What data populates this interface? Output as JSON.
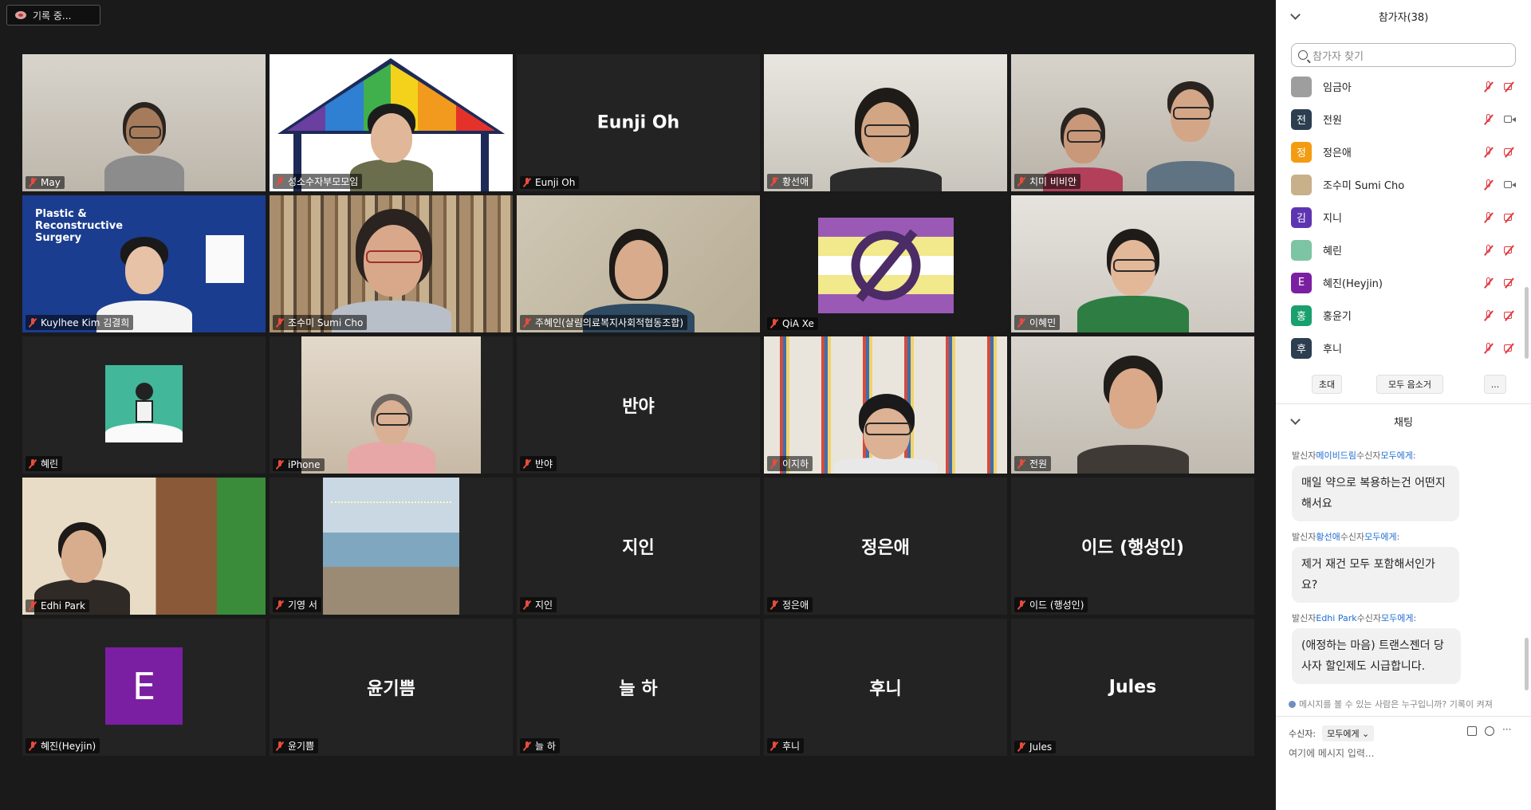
{
  "recording": {
    "label": "기록 중..."
  },
  "tiles": [
    {
      "label": "May",
      "center": ""
    },
    {
      "label": "성소수자부모모임",
      "center": ""
    },
    {
      "label": "Eunji Oh",
      "center": "Eunji Oh"
    },
    {
      "label": "황선애",
      "center": ""
    },
    {
      "label": "치미 비비안",
      "center": ""
    },
    {
      "label": "Kuylhee Kim 김결희",
      "center": "",
      "poster_text": "Plastic & Reconstructive Surgery"
    },
    {
      "label": "조수미 Sumi Cho",
      "center": ""
    },
    {
      "label": "주혜인(살림의료복지사회적협동조합)",
      "center": ""
    },
    {
      "label": "QiA Xe",
      "center": "",
      "active": true
    },
    {
      "label": "이혜민",
      "center": ""
    },
    {
      "label": "혜린",
      "center": ""
    },
    {
      "label": "iPhone",
      "center": ""
    },
    {
      "label": "반야",
      "center": "반야"
    },
    {
      "label": "이지하",
      "center": ""
    },
    {
      "label": "전원",
      "center": ""
    },
    {
      "label": "Edhi Park",
      "center": ""
    },
    {
      "label": "기영 서",
      "center": ""
    },
    {
      "label": "지인",
      "center": "지인"
    },
    {
      "label": "정은애",
      "center": "정은애"
    },
    {
      "label": "이드 (행성인)",
      "center": "이드 (행성인)"
    },
    {
      "label": "혜진(Heyjin)",
      "center": "",
      "avatar_letter": "E",
      "avatar_color": "#7b1fa2"
    },
    {
      "label": "윤기쁨",
      "center": "윤기쁨"
    },
    {
      "label": "늘 하",
      "center": "늘 하"
    },
    {
      "label": "후니",
      "center": "후니"
    },
    {
      "label": "Jules",
      "center": "Jules"
    }
  ],
  "participants_panel": {
    "title": "참가자(38)",
    "search_placeholder": "참가자 찾기",
    "items": [
      {
        "avatar": "",
        "avatar_color": "#9e9e9e",
        "name": "임금아",
        "camera": "off"
      },
      {
        "avatar": "전",
        "avatar_color": "#2c3e50",
        "name": "전원",
        "camera": "on"
      },
      {
        "avatar": "정",
        "avatar_color": "#f39c12",
        "name": "정은애",
        "camera": "off"
      },
      {
        "avatar": "",
        "avatar_color": "#c8b08a",
        "name": "조수미 Sumi Cho",
        "camera": "on"
      },
      {
        "avatar": "김",
        "avatar_color": "#5e35b1",
        "name": "지니",
        "camera": "off"
      },
      {
        "avatar": "",
        "avatar_color": "#7cc4a3",
        "name": "혜린",
        "camera": "off"
      },
      {
        "avatar": "E",
        "avatar_color": "#7b1fa2",
        "name": "혜진(Heyjin)",
        "camera": "off"
      },
      {
        "avatar": "홍",
        "avatar_color": "#1aa06d",
        "name": "홍윤기",
        "camera": "off"
      },
      {
        "avatar": "후",
        "avatar_color": "#2c3e50",
        "name": "후니",
        "camera": "off"
      }
    ],
    "buttons": {
      "invite": "초대",
      "mute_all": "모두 음소거",
      "more": "..."
    }
  },
  "chat_panel": {
    "title": "채팅",
    "messages": [
      {
        "from_prefix": "발신자",
        "sender": "메이비드림",
        "to_prefix": "수신자",
        "recipient": "모두에게",
        "suffix": ":",
        "text": "매일 약으로 복용하는건 어떤지해서요"
      },
      {
        "from_prefix": "발신자",
        "sender": "황선애",
        "to_prefix": "수신자",
        "recipient": "모두에게",
        "suffix": ":",
        "text": "제거 재건 모두 포함해서인가요?"
      },
      {
        "from_prefix": "발신자",
        "sender": "Edhi Park",
        "to_prefix": "수신자",
        "recipient": "모두에게",
        "suffix": ":",
        "text": "(애정하는 마음) 트랜스젠더 당사자 할인제도 시급합니다."
      }
    ],
    "visibility_notice": "메시지를 볼 수 있는 사람은 누구입니까? 기록이 켜져",
    "recipient_label": "수신자:",
    "recipient_value": "모두에게",
    "input_placeholder": "여기에 메시지 입력..."
  }
}
